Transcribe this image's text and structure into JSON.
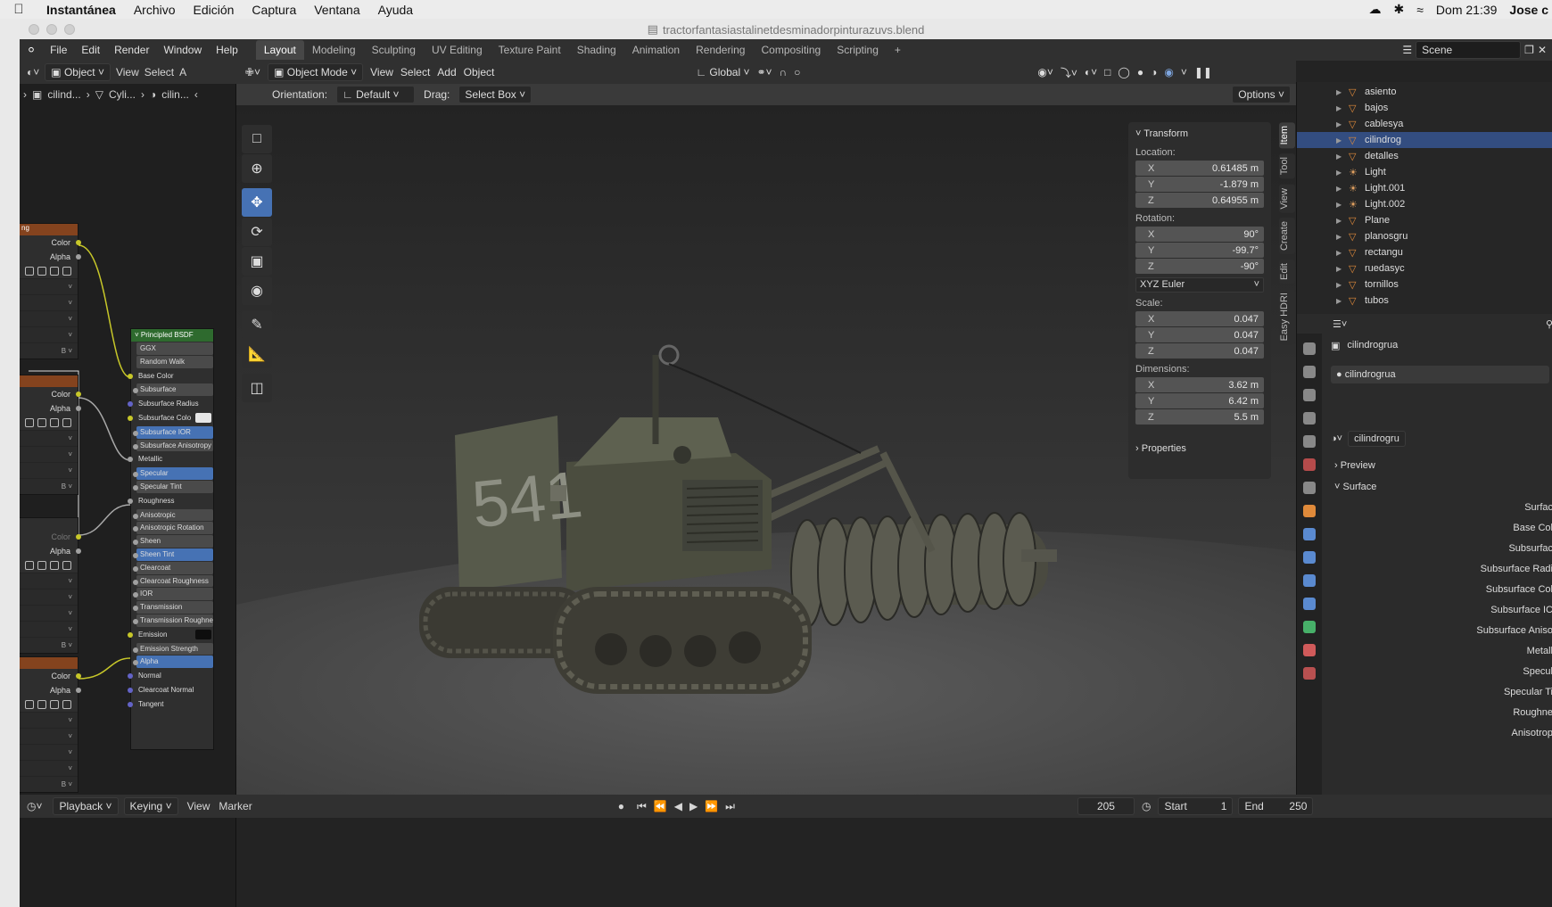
{
  "menubar": {
    "app": "Instantánea",
    "items": [
      "Archivo",
      "Edición",
      "Captura",
      "Ventana",
      "Ayuda"
    ],
    "clock": "Dom 21:39",
    "user": "Jose c"
  },
  "window": {
    "title": "tractorfantasiastalinetdesminadorpinturazuvs.blend"
  },
  "topbar": {
    "menus": [
      "File",
      "Edit",
      "Render",
      "Window",
      "Help"
    ],
    "workspaces": [
      "Layout",
      "Modeling",
      "Sculpting",
      "UV Editing",
      "Texture Paint",
      "Shading",
      "Animation",
      "Rendering",
      "Compositing",
      "Scripting"
    ],
    "active_workspace": "Layout",
    "scene": "Scene"
  },
  "node_editor": {
    "mode": "Object",
    "menus": [
      "View",
      "Select",
      "A"
    ],
    "breadcrumb": [
      "cilind...",
      "Cyli...",
      "cilin..."
    ],
    "image_nodes": [
      {
        "title": "ng",
        "outputs": [
          "Color",
          "Alpha"
        ]
      },
      {
        "title": "",
        "outputs": [
          "Color",
          "Alpha"
        ]
      },
      {
        "title": "",
        "outputs": [
          "Color",
          "Alpha"
        ]
      },
      {
        "title": "",
        "outputs": [
          "Color",
          "Alpha"
        ]
      }
    ],
    "bsdf": {
      "title": "Principled BSDF",
      "rows": [
        {
          "label": "GGX",
          "type": "field"
        },
        {
          "label": "Random Walk",
          "type": "field"
        },
        {
          "label": "Base Color",
          "type": "in",
          "sock": "y"
        },
        {
          "label": "Subsurface",
          "type": "field",
          "sock": "g"
        },
        {
          "label": "Subsurface Radius",
          "type": "in",
          "sock": "b"
        },
        {
          "label": "Subsurface Colo",
          "type": "in",
          "sock": "y",
          "swatch": "light"
        },
        {
          "label": "Subsurface IOR",
          "type": "field",
          "sock": "g",
          "sel": true
        },
        {
          "label": "Subsurface Anisotropy",
          "type": "field",
          "sock": "g"
        },
        {
          "label": "Metallic",
          "type": "in",
          "sock": "g"
        },
        {
          "label": "Specular",
          "type": "field",
          "sock": "g",
          "sel": true
        },
        {
          "label": "Specular Tint",
          "type": "field",
          "sock": "g"
        },
        {
          "label": "Roughness",
          "type": "in",
          "sock": "g"
        },
        {
          "label": "Anisotropic",
          "type": "field",
          "sock": "g"
        },
        {
          "label": "Anisotropic Rotation",
          "type": "field",
          "sock": "g"
        },
        {
          "label": "Sheen",
          "type": "field",
          "sock": "g"
        },
        {
          "label": "Sheen Tint",
          "type": "field",
          "sock": "g",
          "sel": true
        },
        {
          "label": "Clearcoat",
          "type": "field",
          "sock": "g"
        },
        {
          "label": "Clearcoat Roughness",
          "type": "field",
          "sock": "g"
        },
        {
          "label": "IOR",
          "type": "field",
          "sock": "g"
        },
        {
          "label": "Transmission",
          "type": "field",
          "sock": "g"
        },
        {
          "label": "Transmission Roughne",
          "type": "field",
          "sock": "g"
        },
        {
          "label": "Emission",
          "type": "in",
          "sock": "y",
          "swatch": "dark"
        },
        {
          "label": "Emission Strength",
          "type": "field",
          "sock": "g"
        },
        {
          "label": "Alpha",
          "type": "field",
          "sock": "g",
          "sel": true
        },
        {
          "label": "Normal",
          "type": "in",
          "sock": "b"
        },
        {
          "label": "Clearcoat Normal",
          "type": "in",
          "sock": "b"
        },
        {
          "label": "Tangent",
          "type": "in",
          "sock": "b"
        }
      ]
    }
  },
  "viewport": {
    "mode": "Object Mode",
    "menus": [
      "View",
      "Select",
      "Add",
      "Object"
    ],
    "transform_orientation": "Global",
    "orientation_label": "Orientation:",
    "orientation_value": "Default",
    "drag_label": "Drag:",
    "drag_value": "Select Box",
    "options": "Options",
    "vehicle_number": "541"
  },
  "npanel": {
    "transform": "Transform",
    "location_label": "Location:",
    "location": [
      {
        "ax": "X",
        "v": "0.61485 m"
      },
      {
        "ax": "Y",
        "v": "-1.879 m"
      },
      {
        "ax": "Z",
        "v": "0.64955 m"
      }
    ],
    "rotation_label": "Rotation:",
    "rotation": [
      {
        "ax": "X",
        "v": "90°"
      },
      {
        "ax": "Y",
        "v": "-99.7°"
      },
      {
        "ax": "Z",
        "v": "-90°"
      }
    ],
    "rotation_mode": "XYZ Euler",
    "scale_label": "Scale:",
    "scale": [
      {
        "ax": "X",
        "v": "0.047"
      },
      {
        "ax": "Y",
        "v": "0.047"
      },
      {
        "ax": "Z",
        "v": "0.047"
      }
    ],
    "dimensions_label": "Dimensions:",
    "dimensions": [
      {
        "ax": "X",
        "v": "3.62 m"
      },
      {
        "ax": "Y",
        "v": "6.42 m"
      },
      {
        "ax": "Z",
        "v": "5.5 m"
      }
    ],
    "properties": "Properties",
    "tabs": [
      "Item",
      "Tool",
      "View",
      "Create",
      "Edit",
      "Easy HDRI"
    ],
    "active_tab": "Item"
  },
  "outliner": {
    "items": [
      {
        "name": "asiento",
        "type": "mesh"
      },
      {
        "name": "bajos",
        "type": "mesh"
      },
      {
        "name": "cablesya",
        "type": "mesh"
      },
      {
        "name": "cilindrog",
        "type": "mesh",
        "selected": true
      },
      {
        "name": "detalles",
        "type": "mesh"
      },
      {
        "name": "Light",
        "type": "light"
      },
      {
        "name": "Light.001",
        "type": "light"
      },
      {
        "name": "Light.002",
        "type": "light"
      },
      {
        "name": "Plane",
        "type": "mesh"
      },
      {
        "name": "planosgru",
        "type": "mesh"
      },
      {
        "name": "rectangu",
        "type": "mesh"
      },
      {
        "name": "ruedasyc",
        "type": "mesh"
      },
      {
        "name": "tornillos",
        "type": "mesh"
      },
      {
        "name": "tubos",
        "type": "mesh"
      }
    ]
  },
  "properties": {
    "object": "cilindrogrua",
    "material": "cilindrogrua",
    "material_slot": "cilindrogru",
    "sections": [
      "Preview",
      "Surface"
    ],
    "surface_rows": [
      "Surfac",
      "Base Col",
      "Subsurfac",
      "Subsurface Radi",
      "Subsurface Col",
      "Subsurface IC",
      "Subsurface Aniso",
      "Metall",
      "Specul",
      "Specular Ti",
      "Roughne",
      "Anisotrop"
    ]
  },
  "timeline": {
    "menus": [
      "Playback",
      "Keying",
      "View",
      "Marker"
    ],
    "current_frame": "205",
    "start_label": "Start",
    "start": "1",
    "end_label": "End",
    "end": "250"
  },
  "colors": {
    "accent": "#4672b4",
    "node_image_header": "#84431e",
    "node_shader_header": "#2e6a2e",
    "outliner_selected": "#334d80"
  }
}
